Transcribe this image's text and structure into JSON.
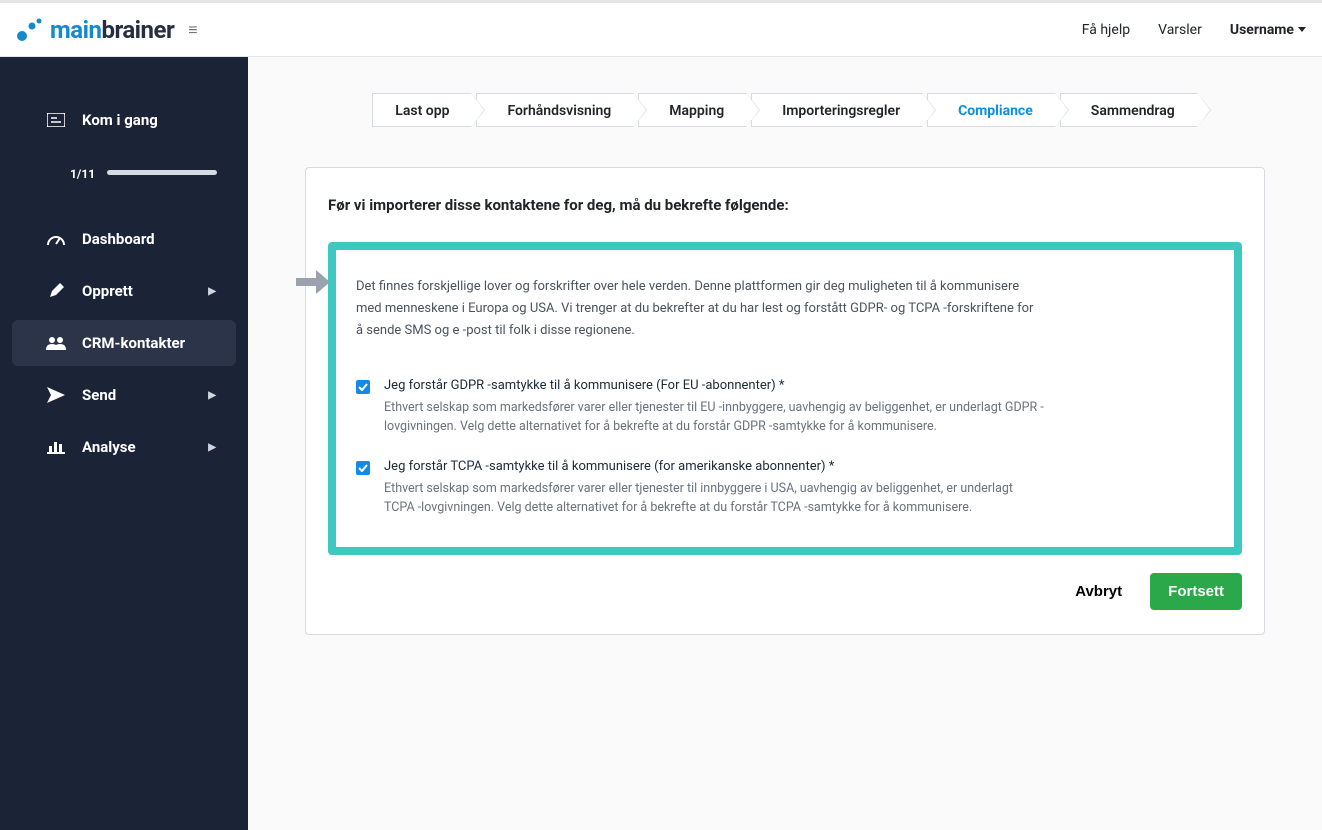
{
  "header": {
    "logo_main": "main",
    "logo_brainer": "brainer",
    "help": "Få hjelp",
    "alerts": "Varsler",
    "username": "Username"
  },
  "sidebar": {
    "get_started": "Kom i gang",
    "progress": "1/11",
    "dashboard": "Dashboard",
    "create": "Opprett",
    "crm": "CRM-kontakter",
    "send": "Send",
    "analyse": "Analyse"
  },
  "steps": {
    "s1": "Last opp",
    "s2": "Forhåndsvisning",
    "s3": "Mapping",
    "s4": "Importeringsregler",
    "s5": "Compliance",
    "s6": "Sammendrag"
  },
  "panel": {
    "title": "Før vi importerer disse kontaktene for deg, må du bekrefte følgende:",
    "intro": "Det finnes forskjellige lover og forskrifter over hele verden. Denne plattformen gir deg muligheten til å kommunisere med menneskene i Europa og USA. Vi trenger at du bekrefter at du har lest og forstått GDPR- og TCPA -forskriftene for å sende SMS og e -post til folk i disse regionene.",
    "gdpr_label": "Jeg forstår GDPR -samtykke til å kommunisere (For EU -abonnenter) *",
    "gdpr_desc": "Ethvert selskap som markedsfører varer eller tjenester til EU -innbyggere, uavhengig av beliggenhet, er underlagt GDPR -lovgivningen. Velg dette alternativet for å bekrefte at du forstår GDPR -samtykke for å kommunisere.",
    "tcpa_label": "Jeg forstår TCPA -samtykke til å kommunisere (for amerikanske abonnenter) *",
    "tcpa_desc": "Ethvert selskap som markedsfører varer eller tjenester til innbyggere i USA, uavhengig av beliggenhet, er underlagt TCPA -lovgivningen. Velg dette alternativet for å bekrefte at du forstår TCPA -samtykke for å kommunisere.",
    "cancel": "Avbryt",
    "continue": "Fortsett"
  }
}
